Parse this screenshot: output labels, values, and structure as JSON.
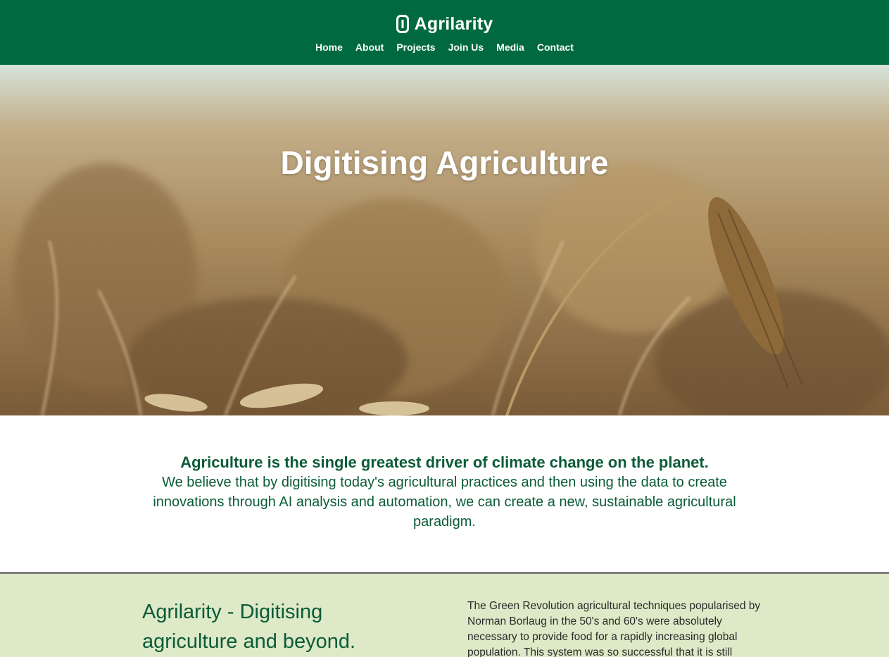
{
  "brand": {
    "name": "Agrilarity",
    "colors": {
      "primary": "#006a3e",
      "accent": "#dde9c7",
      "text": "#0b5b38"
    }
  },
  "nav": {
    "items": [
      {
        "label": "Home"
      },
      {
        "label": "About"
      },
      {
        "label": "Projects"
      },
      {
        "label": "Join Us"
      },
      {
        "label": "Media"
      },
      {
        "label": "Contact"
      }
    ]
  },
  "hero": {
    "title": "Digitising Agriculture",
    "control_icon": "pause-icon"
  },
  "intro": {
    "heading": "Agriculture is the single greatest driver of climate change on the planet.",
    "body": "We believe that by digitising today's agricultural practices and then using the data to create innovations through AI analysis and automation, we can create a new, sustainable agricultural paradigm."
  },
  "about": {
    "heading": "Agrilarity - Digitising agriculture and beyond.",
    "body": "The Green Revolution agricultural techniques popularised by Norman Borlaug in the 50's and 60's were absolutely necessary to provide food for a rapidly increasing global population. This system was so successful that it is still"
  }
}
